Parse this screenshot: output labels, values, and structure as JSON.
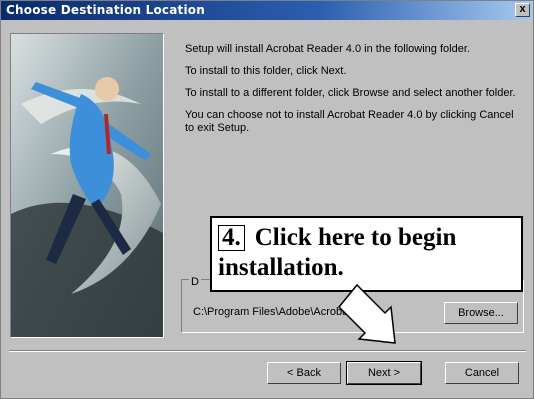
{
  "window": {
    "title": "Choose Destination Location",
    "close_label": "x"
  },
  "body_text": {
    "p1": "Setup will install Acrobat Reader 4.0 in the following folder.",
    "p2": "To install to this folder, click Next.",
    "p3": "To install to a different folder, click Browse and select another folder.",
    "p4": "You can choose not to install Acrobat Reader 4.0 by clicking Cancel to exit Setup."
  },
  "destination": {
    "group_label": "D",
    "path": "C:\\Program Files\\Adobe\\Acrobat 4.0"
  },
  "buttons": {
    "browse": "Browse...",
    "back": "< Back",
    "next": "Next >",
    "cancel": "Cancel"
  },
  "callout": {
    "step": "4.",
    "text_line1": "Click here to begin",
    "text_line2": "installation."
  },
  "colors": {
    "titlebar_start": "#0a2a6b",
    "titlebar_end": "#a6caf0",
    "dialog_bg": "#c0c0c0"
  },
  "icons": [
    "close-icon",
    "arrow-pointer-icon",
    "runner-illustration"
  ]
}
